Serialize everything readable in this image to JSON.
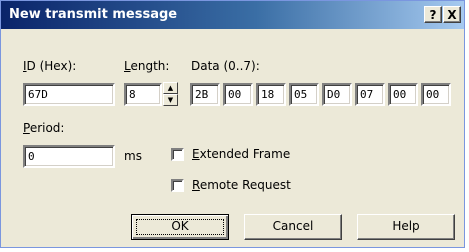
{
  "window": {
    "title": "New transmit message",
    "help_btn": "?",
    "close_btn": "X"
  },
  "labels": {
    "id_hex": "ID (Hex):",
    "length": "Length:",
    "data": "Data (0..7):",
    "period": "Period:",
    "ms": "ms",
    "extended_frame": "Extended Frame",
    "remote_request": "Remote Request"
  },
  "fields": {
    "id_value": "67D",
    "length_value": "8",
    "period_value": "0",
    "data_bytes": [
      "2B",
      "00",
      "18",
      "05",
      "D0",
      "07",
      "00",
      "00"
    ]
  },
  "checkboxes": {
    "extended_frame_checked": false,
    "remote_request_checked": false
  },
  "buttons": {
    "ok": "OK",
    "cancel": "Cancel",
    "help": "Help"
  },
  "icons": {
    "spin_up": "spin-up-arrow-icon",
    "spin_down": "spin-down-arrow-icon"
  }
}
